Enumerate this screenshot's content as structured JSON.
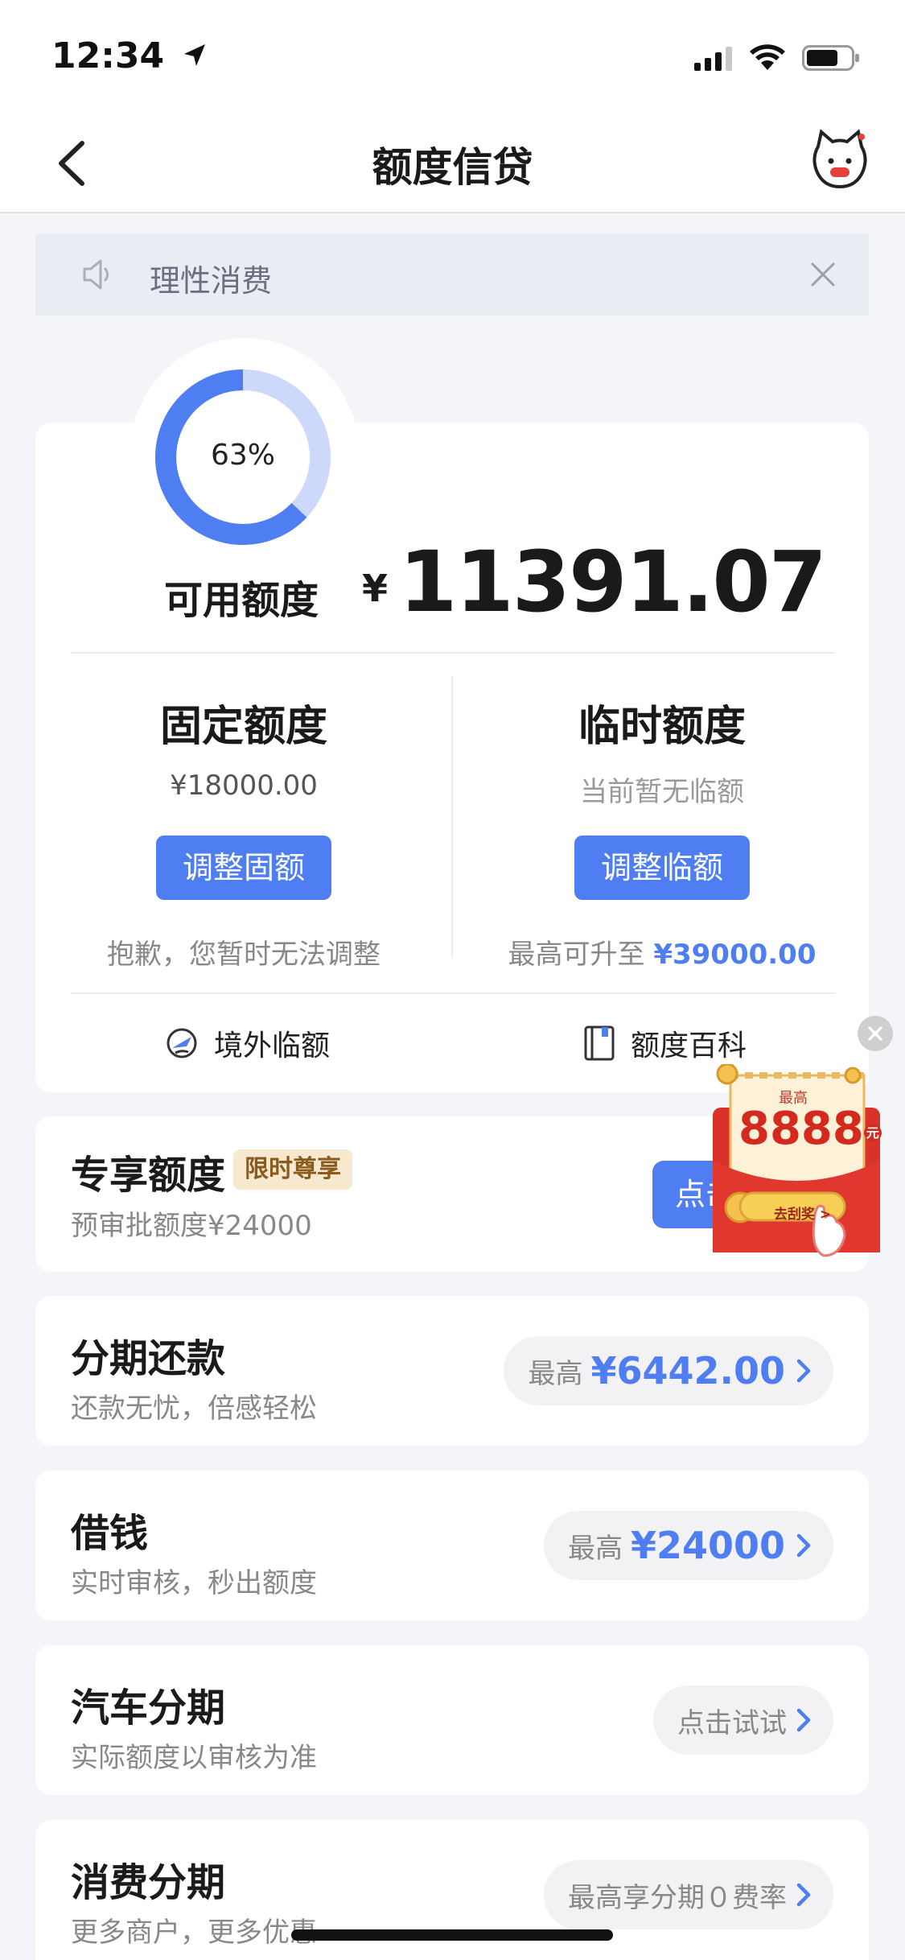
{
  "status_bar": {
    "time": "12:34"
  },
  "nav": {
    "title": "额度信贷"
  },
  "notice": {
    "text": "理性消费"
  },
  "credit": {
    "usage_percent": 63,
    "usage_label": "63%",
    "available_label": "可用额度",
    "currency": "¥",
    "available_amount": "11391.07",
    "fixed": {
      "title": "固定额度",
      "amount": "¥18000.00",
      "button": "调整固额",
      "note": "抱歉，您暂时无法调整"
    },
    "temporary": {
      "title": "临时额度",
      "status": "当前暂无临额",
      "button": "调整临额",
      "note_prefix": "最高可升至",
      "note_amount": "¥39000.00"
    },
    "shortcuts": {
      "overseas": "境外临额",
      "wiki": "额度百科"
    }
  },
  "exclusive": {
    "title": "专享额度",
    "badge": "限时尊享",
    "sub": "预审批额度¥24000",
    "button": "点击"
  },
  "promo": {
    "top": "最高",
    "amount": "8888",
    "unit": "元",
    "action": "去刮奖 >"
  },
  "rows": [
    {
      "title": "分期还款",
      "sub": "还款无忧，倍感轻松",
      "pill_label": "最高",
      "pill_value": "¥6442.00"
    },
    {
      "title": "借钱",
      "sub": "实时审核，秒出额度",
      "pill_label": "最高",
      "pill_value": "¥24000"
    },
    {
      "title": "汽车分期",
      "sub": "实际额度以审核为准",
      "pill_label": "点击试试",
      "pill_value": ""
    },
    {
      "title": "消费分期",
      "sub": "更多商户，更多优惠",
      "pill_label": "最高享分期０费率",
      "pill_value": ""
    }
  ],
  "colors": {
    "accent": "#4e7ef2",
    "ring_track": "#cdd9fb",
    "badge_bg": "#f7e9cf",
    "promo_red": "#d42a1e"
  }
}
